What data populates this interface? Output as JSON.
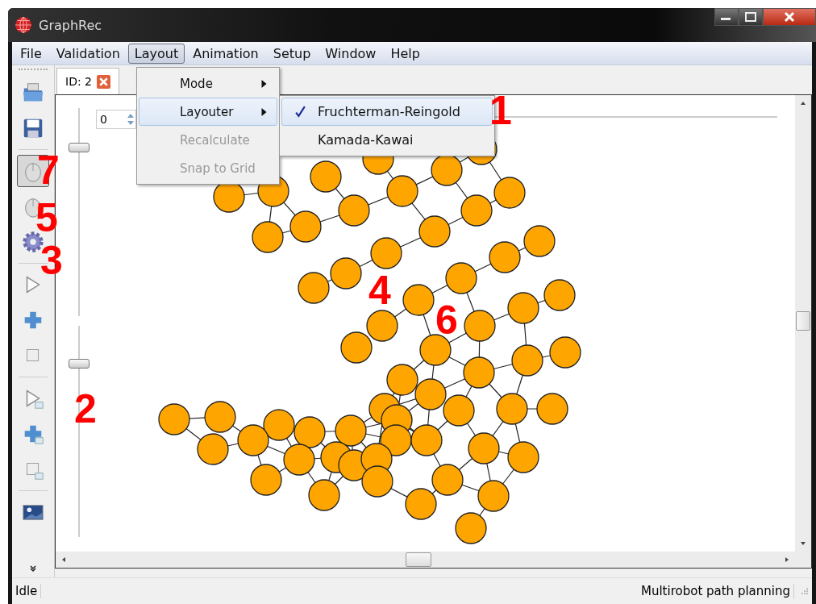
{
  "window": {
    "title": "GraphRec"
  },
  "menubar": [
    {
      "label": "File",
      "selected": false
    },
    {
      "label": "Validation",
      "selected": false
    },
    {
      "label": "Layout",
      "selected": true
    },
    {
      "label": "Animation",
      "selected": false
    },
    {
      "label": "Setup",
      "selected": false
    },
    {
      "label": "Window",
      "selected": false
    },
    {
      "label": "Help",
      "selected": false
    }
  ],
  "layout_menu": [
    {
      "label": "Mode",
      "submenu": true,
      "disabled": false,
      "selected": false
    },
    {
      "label": "Layouter",
      "submenu": true,
      "disabled": false,
      "selected": true
    },
    {
      "label": "Recalculate",
      "submenu": false,
      "disabled": true,
      "selected": false
    },
    {
      "label": "Snap to Grid",
      "submenu": false,
      "disabled": true,
      "selected": false
    }
  ],
  "layouter_menu": [
    {
      "label": "Fruchterman-Reingold",
      "checked": true,
      "selected": true
    },
    {
      "label": "Kamada-Kawai",
      "checked": false,
      "selected": false
    }
  ],
  "toolbar": {
    "groups": [
      [
        {
          "kind": "open",
          "selected": false
        },
        {
          "kind": "save",
          "selected": false
        }
      ],
      [
        {
          "kind": "mouse",
          "selected": true
        },
        {
          "kind": "mouse-alt",
          "selected": false
        },
        {
          "kind": "gear",
          "selected": false
        }
      ],
      [
        {
          "kind": "play",
          "selected": false
        },
        {
          "kind": "plus",
          "selected": false
        },
        {
          "kind": "stop",
          "selected": false
        }
      ],
      [
        {
          "kind": "play-window",
          "selected": false
        },
        {
          "kind": "plus-window",
          "selected": false
        },
        {
          "kind": "stop-window",
          "selected": false
        }
      ],
      [
        {
          "kind": "image",
          "selected": false
        }
      ]
    ]
  },
  "tabs": [
    {
      "label": "ID: 2",
      "selected": true
    }
  ],
  "canvas": {
    "spinbox": "0",
    "sliders": [
      {
        "level": 0.81
      },
      {
        "level": 0.82
      }
    ]
  },
  "annotations": [
    "1",
    "7",
    "5",
    "3",
    "4",
    "6",
    "2"
  ],
  "status_bar": {
    "left": "Idle",
    "right": "Multirobot path planning"
  }
}
